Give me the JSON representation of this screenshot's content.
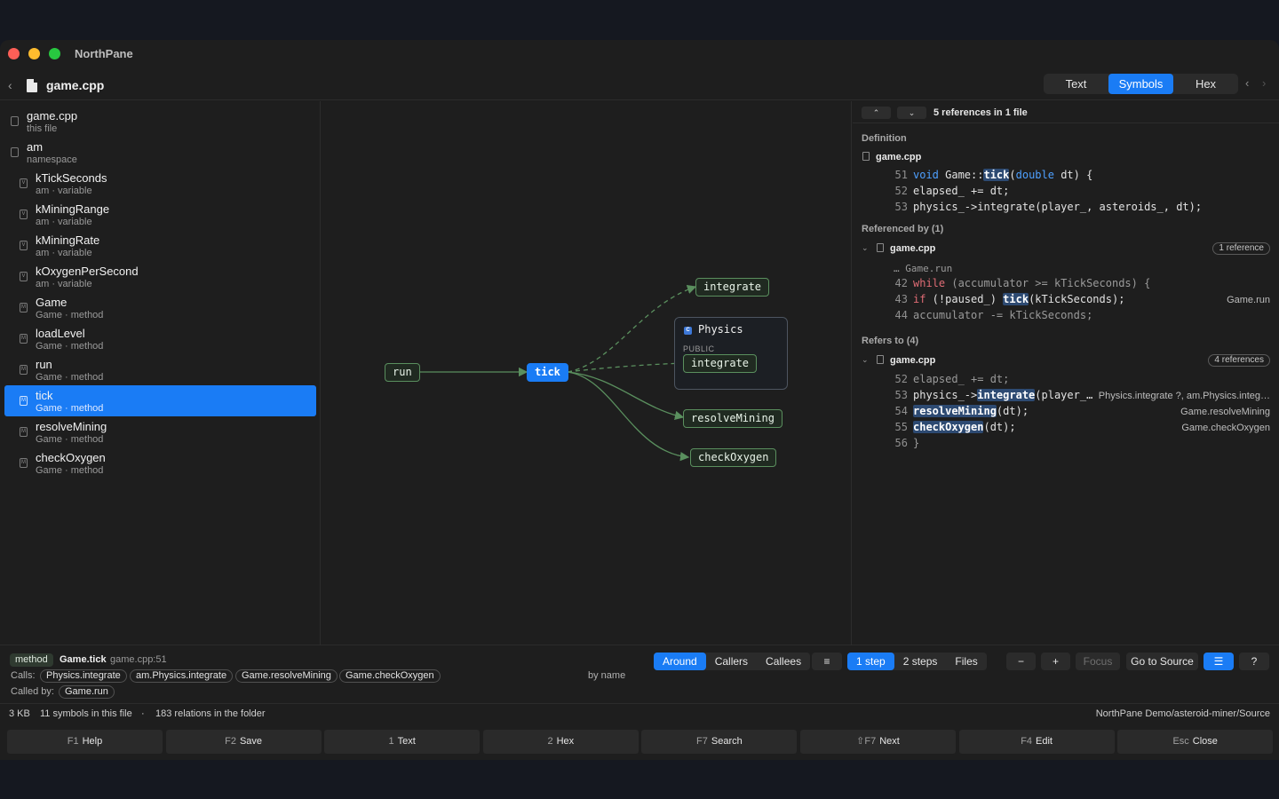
{
  "app_title": "NorthPane",
  "file": {
    "name": "game.cpp"
  },
  "view_tabs": [
    {
      "label": "Text",
      "active": false
    },
    {
      "label": "Symbols",
      "active": true
    },
    {
      "label": "Hex",
      "active": false
    }
  ],
  "symbols": [
    {
      "name": "game.cpp",
      "sub": "this file",
      "icon": "file-icon",
      "selected": false,
      "indent": false
    },
    {
      "name": "am",
      "sub": "namespace",
      "icon": "namespace-icon",
      "selected": false,
      "indent": false
    },
    {
      "name": "kTickSeconds",
      "sub": "am · variable",
      "icon": "variable-icon",
      "selected": false,
      "indent": true
    },
    {
      "name": "kMiningRange",
      "sub": "am · variable",
      "icon": "variable-icon",
      "selected": false,
      "indent": true
    },
    {
      "name": "kMiningRate",
      "sub": "am · variable",
      "icon": "variable-icon",
      "selected": false,
      "indent": true
    },
    {
      "name": "kOxygenPerSecond",
      "sub": "am · variable",
      "icon": "variable-icon",
      "selected": false,
      "indent": true
    },
    {
      "name": "Game",
      "sub": "Game · method",
      "icon": "method-icon",
      "selected": false,
      "indent": true
    },
    {
      "name": "loadLevel",
      "sub": "Game · method",
      "icon": "method-icon",
      "selected": false,
      "indent": true
    },
    {
      "name": "run",
      "sub": "Game · method",
      "icon": "method-icon",
      "selected": false,
      "indent": true
    },
    {
      "name": "tick",
      "sub": "Game · method",
      "icon": "method-icon",
      "selected": true,
      "indent": true
    },
    {
      "name": "resolveMining",
      "sub": "Game · method",
      "icon": "method-icon",
      "selected": false,
      "indent": true
    },
    {
      "name": "checkOxygen",
      "sub": "Game · method",
      "icon": "method-icon",
      "selected": false,
      "indent": true
    }
  ],
  "graph": {
    "nodes": {
      "run": "run",
      "tick": "tick",
      "integrate_top": "integrate",
      "integrate_inner": "integrate",
      "resolveMining": "resolveMining",
      "checkOxygen": "checkOxygen"
    },
    "cluster": {
      "title": "Physics",
      "visibility": "PUBLIC",
      "icon_letter": "C"
    }
  },
  "references": {
    "count_label": "5 references in 1 file",
    "definition": {
      "section": "Definition",
      "file": "game.cpp",
      "lines": [
        {
          "num": "51",
          "text": "void Game::tick(double dt) {"
        },
        {
          "num": "52",
          "text": "elapsed_ += dt;"
        },
        {
          "num": "53",
          "text": "physics_->integrate(player_, asteroids_, dt);"
        }
      ]
    },
    "referenced_by": {
      "section": "Referenced by (1)",
      "file": "game.cpp",
      "badge": "1 reference",
      "context": "… Game.run",
      "lines": [
        {
          "num": "42",
          "text": "while (accumulator >= kTickSeconds) {",
          "right": ""
        },
        {
          "num": "43",
          "text": "if (!paused_) tick(kTickSeconds);",
          "right": "Game.run"
        },
        {
          "num": "44",
          "text": "accumulator -= kTickSeconds;",
          "right": ""
        }
      ]
    },
    "refers_to": {
      "section": "Refers to (4)",
      "file": "game.cpp",
      "badge": "4 references",
      "lines": [
        {
          "num": "52",
          "text": "elapsed_ += dt;",
          "right": ""
        },
        {
          "num": "53",
          "text": "physics_->integrate(player_…",
          "right": "Physics.integrate ?, am.Physics.integ…"
        },
        {
          "num": "54",
          "text": "resolveMining(dt);",
          "right": "Game.resolveMining"
        },
        {
          "num": "55",
          "text": "checkOxygen(dt);",
          "right": "Game.checkOxygen"
        },
        {
          "num": "56",
          "text": "}",
          "right": ""
        }
      ]
    }
  },
  "info": {
    "kind": "method",
    "symbol": "Game.tick",
    "location": "game.cpp:51",
    "calls_label": "Calls:",
    "calls": [
      "Physics.integrate",
      "am.Physics.integrate",
      "Game.resolveMining",
      "Game.checkOxygen"
    ],
    "called_by_label": "Called by:",
    "called_by": [
      "Game.run"
    ],
    "sort_label": "by name",
    "direction_tabs": [
      "Around",
      "Callers",
      "Callees"
    ],
    "depth_tabs": [
      "1 step",
      "2 steps",
      "Files"
    ],
    "focus_label": "Focus",
    "goto_label": "Go to Source"
  },
  "status": {
    "size": "3 KB",
    "symbols": "11 symbols in this file",
    "sep": "·",
    "relations": "183 relations in the folder",
    "path": "NorthPane Demo/asteroid-miner/Source"
  },
  "fkeys": [
    {
      "key": "F1",
      "label": "Help"
    },
    {
      "key": "F2",
      "label": "Save"
    },
    {
      "key": "1",
      "label": "Text"
    },
    {
      "key": "2",
      "label": "Hex"
    },
    {
      "key": "F7",
      "label": "Search"
    },
    {
      "key": "⇧F7",
      "label": "Next"
    },
    {
      "key": "F4",
      "label": "Edit"
    },
    {
      "key": "Esc",
      "label": "Close"
    }
  ],
  "colors": {
    "accent": "#1a7cf5",
    "edge": "#5a8f5e",
    "keyword": "#4ea0ff",
    "keyword_flow": "#e06c75"
  }
}
